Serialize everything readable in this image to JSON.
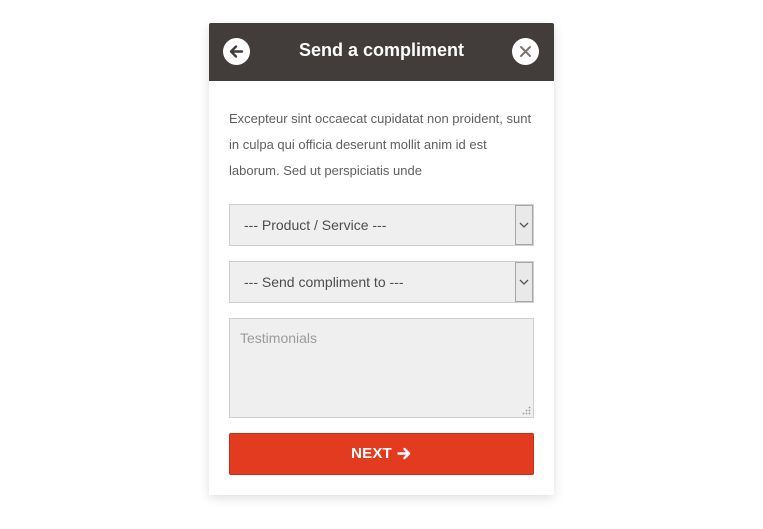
{
  "header": {
    "title": "Send a compliment",
    "back_icon": "arrow-left-icon",
    "close_icon": "close-icon"
  },
  "description": "Excepteur sint occaecat cupidatat non proident, sunt in culpa qui officia deserunt mollit anim id est laborum. Sed ut perspiciatis unde",
  "form": {
    "product_select": {
      "value": "--- Product / Service ---"
    },
    "recipient_select": {
      "value": "--- Send compliment to ---"
    },
    "testimonials": {
      "placeholder": "Testimonials",
      "value": ""
    },
    "next_button": {
      "label": "NEXT",
      "icon": "arrow-right-icon"
    }
  },
  "colors": {
    "header_bg": "#423c3a",
    "accent": "#e33b1f",
    "field_bg": "#efefef"
  }
}
